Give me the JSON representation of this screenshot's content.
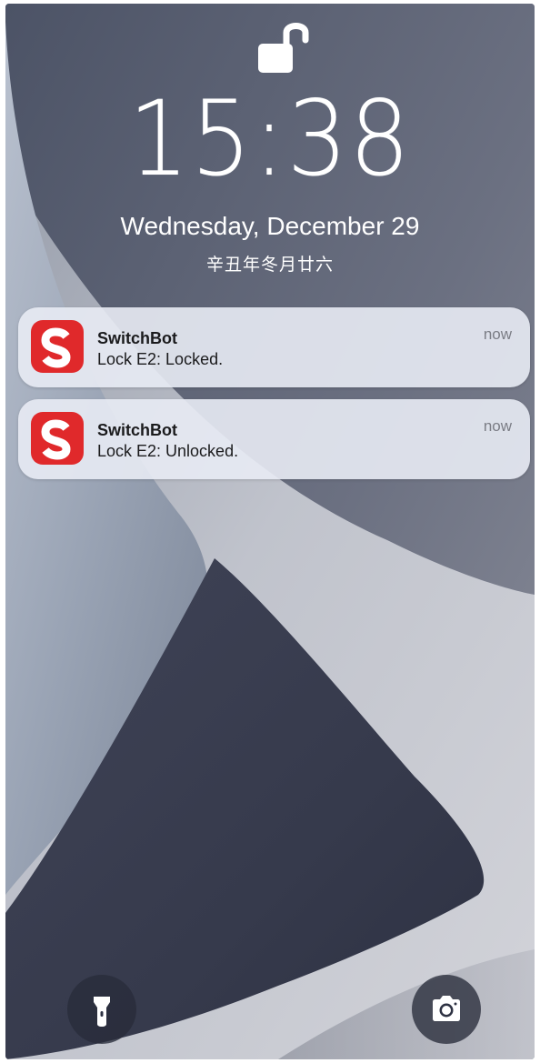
{
  "status": {
    "lock_state_icon": "unlocked-padlock-icon"
  },
  "lockscreen": {
    "time": "15:38",
    "date": "Wednesday, December 29",
    "lunar_date": "辛丑年冬月廿六"
  },
  "notifications": [
    {
      "app_name": "SwitchBot",
      "message": "Lock E2: Locked.",
      "time": "now",
      "icon": "switchbot-app-icon"
    },
    {
      "app_name": "SwitchBot",
      "message": "Lock E2: Unlocked.",
      "time": "now",
      "icon": "switchbot-app-icon"
    }
  ],
  "quick_actions": {
    "left_icon": "flashlight-icon",
    "right_icon": "camera-icon"
  },
  "colors": {
    "app_icon_red": "#e0292b",
    "notification_bg": "#e8ebf4",
    "wallpaper_dark": "#3a3e4e",
    "wallpaper_light": "#c4c6cf"
  }
}
